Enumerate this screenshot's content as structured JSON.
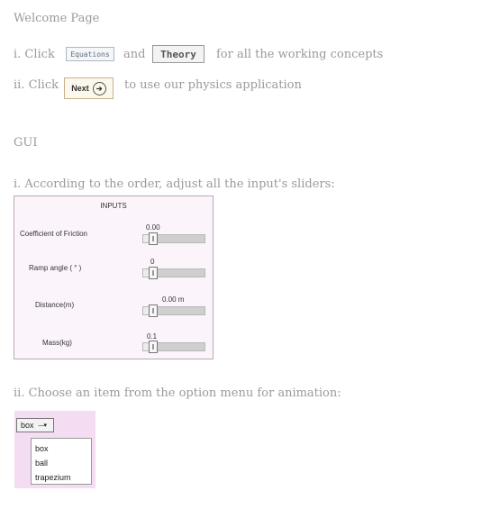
{
  "page_title": "Welcome Page",
  "step1": {
    "prefix": "i. Click",
    "equations_button": "Equations",
    "and": "and",
    "theory_button": "Theory",
    "suffix": "for all the working concepts"
  },
  "step2": {
    "prefix": "ii. Click",
    "next_button": "Next",
    "suffix": "to use our physics application"
  },
  "gui_heading": "GUI",
  "gui_step1": "i. According to the order, adjust all the input's sliders:",
  "inputs": {
    "title": "INPUTS",
    "rows": [
      {
        "label": "Coefficient of Friction",
        "value": "0.00",
        "level": 0
      },
      {
        "label": "Ramp angle ( ° )",
        "value": "0",
        "level": 0
      },
      {
        "label": "Distance(m)",
        "value": "0.00 m",
        "level": 0
      },
      {
        "label": "Mass(kg)",
        "value": "0.1",
        "level": 0
      }
    ]
  },
  "gui_step2": "ii. Choose an item from the option menu for animation:",
  "combo": {
    "selected": "box",
    "options": [
      "box",
      "ball",
      "trapezium"
    ]
  }
}
